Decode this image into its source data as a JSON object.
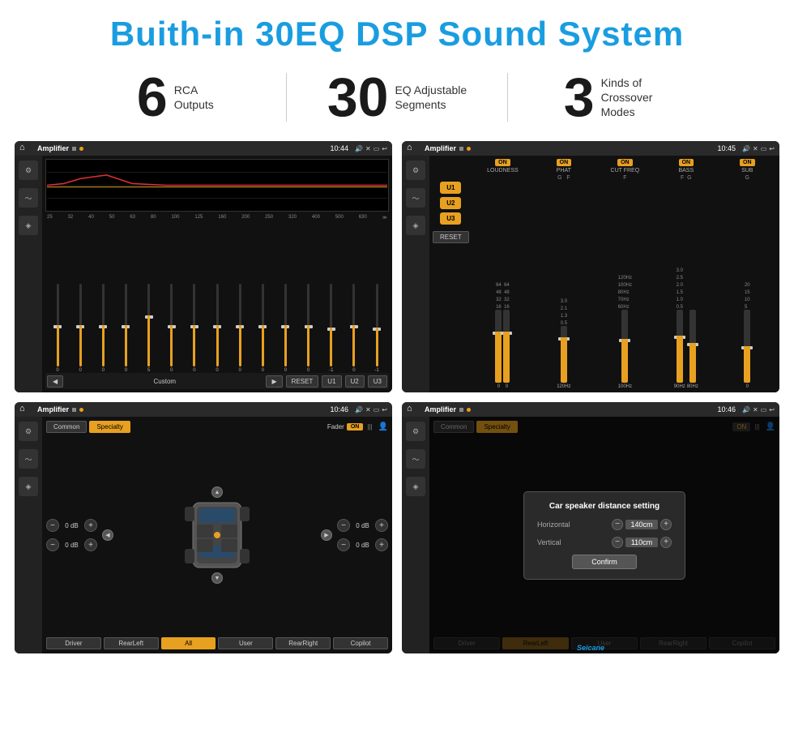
{
  "header": {
    "title": "Buith-in 30EQ DSP Sound System"
  },
  "stats": [
    {
      "number": "6",
      "text_line1": "RCA",
      "text_line2": "Outputs"
    },
    {
      "number": "30",
      "text_line1": "EQ Adjustable",
      "text_line2": "Segments"
    },
    {
      "number": "3",
      "text_line1": "Kinds of",
      "text_line2": "Crossover Modes"
    }
  ],
  "screen1": {
    "status": {
      "app": "Amplifier",
      "time": "10:44"
    },
    "mode": "Custom",
    "buttons": [
      "RESET",
      "U1",
      "U2",
      "U3"
    ],
    "freq_labels": [
      "25",
      "32",
      "40",
      "50",
      "63",
      "80",
      "100",
      "125",
      "160",
      "200",
      "250",
      "320",
      "400",
      "500",
      "630"
    ],
    "eq_values": [
      "0",
      "0",
      "0",
      "0",
      "5",
      "0",
      "0",
      "0",
      "0",
      "0",
      "0",
      "0",
      "-1",
      "0",
      "-1"
    ]
  },
  "screen2": {
    "status": {
      "app": "Amplifier",
      "time": "10:45"
    },
    "channels": [
      "LOUDNESS",
      "PHAT",
      "CUT FREQ",
      "BASS",
      "SUB"
    ],
    "u_labels": [
      "U1",
      "U2",
      "U3"
    ],
    "reset_label": "RESET",
    "on_label": "ON"
  },
  "screen3": {
    "status": {
      "app": "Amplifier",
      "time": "10:46"
    },
    "tabs": [
      "Common",
      "Specialty"
    ],
    "fader_label": "Fader",
    "fader_on": "ON",
    "controls": {
      "top_left": "0 dB",
      "top_right": "0 dB",
      "bottom_left": "0 dB",
      "bottom_right": "0 dB"
    },
    "bottom_buttons": [
      "Driver",
      "RearLeft",
      "All",
      "User",
      "RearRight",
      "Copilot"
    ]
  },
  "screen4": {
    "status": {
      "app": "Amplifier",
      "time": "10:46"
    },
    "tabs": [
      "Common",
      "Specialty"
    ],
    "dialog": {
      "title": "Car speaker distance setting",
      "horizontal_label": "Horizontal",
      "horizontal_value": "140cm",
      "vertical_label": "Vertical",
      "vertical_value": "110cm",
      "confirm_label": "Confirm"
    },
    "bottom_buttons": [
      "Driver",
      "RearLeft",
      "All",
      "User",
      "RearRight",
      "Copilot"
    ],
    "on_label": "ON"
  },
  "watermark": "Seicane"
}
